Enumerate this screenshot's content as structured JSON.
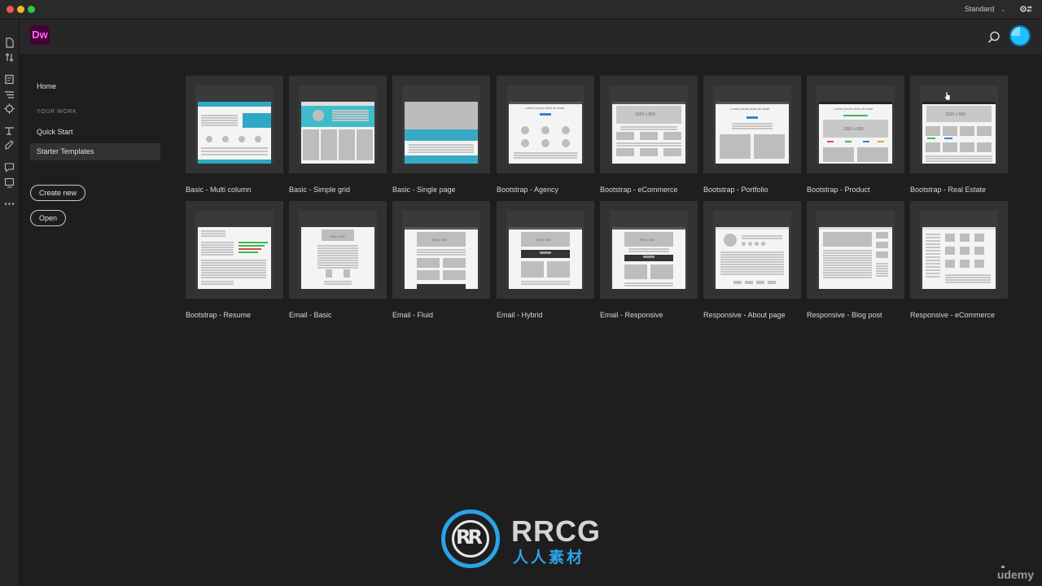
{
  "window": {
    "workspace_label": "Standard",
    "traffic_colors": {
      "close": "#f25650",
      "minimize": "#f6b229",
      "maximize": "#2ec840"
    }
  },
  "app": {
    "logo_text": "Dw",
    "brand_colors": {
      "logo_bg": "#470137",
      "logo_fg": "#ff61f6",
      "accent": "#19a7e0"
    }
  },
  "sidebar": {
    "home": "Home",
    "section_title": "YOUR WORK",
    "quick_start": "Quick Start",
    "starter_templates": "Starter Templates",
    "active_item": "Starter Templates",
    "create_new": "Create new",
    "open": "Open"
  },
  "templates": [
    {
      "label": "Basic - Multi column",
      "preview": "multi-column"
    },
    {
      "label": "Basic - Simple grid",
      "preview": "simple-grid"
    },
    {
      "label": "Basic - Single page",
      "preview": "single-page"
    },
    {
      "label": "Bootstrap - Agency",
      "preview": "agency"
    },
    {
      "label": "Bootstrap - eCommerce",
      "preview": "ecommerce"
    },
    {
      "label": "Bootstrap - Portfolio",
      "preview": "portfolio"
    },
    {
      "label": "Bootstrap - Product",
      "preview": "product"
    },
    {
      "label": "Bootstrap - Real Estate",
      "preview": "real-estate"
    },
    {
      "label": "Bootstrap - Resume",
      "preview": "resume"
    },
    {
      "label": "Email - Basic",
      "preview": "email-basic"
    },
    {
      "label": "Email - Fluid",
      "preview": "email-fluid"
    },
    {
      "label": "Email - Hybrid",
      "preview": "email-hybrid"
    },
    {
      "label": "Email - Responsive",
      "preview": "email-responsive"
    },
    {
      "label": "Responsive - About page",
      "preview": "about-page"
    },
    {
      "label": "Responsive - Blog post",
      "preview": "blog-post"
    },
    {
      "label": "Responsive - eCommerce",
      "preview": "resp-ecommerce"
    }
  ],
  "thumb_text": {
    "lorem_heading": "Lorem ipsum dolor sit amet",
    "hero_size": "1920 x 500",
    "product_size": "1550 x 600",
    "email_size": "600 x 300"
  },
  "watermark": {
    "title": "RRCG",
    "subtitle": "人人素材",
    "badge": "udemy"
  }
}
